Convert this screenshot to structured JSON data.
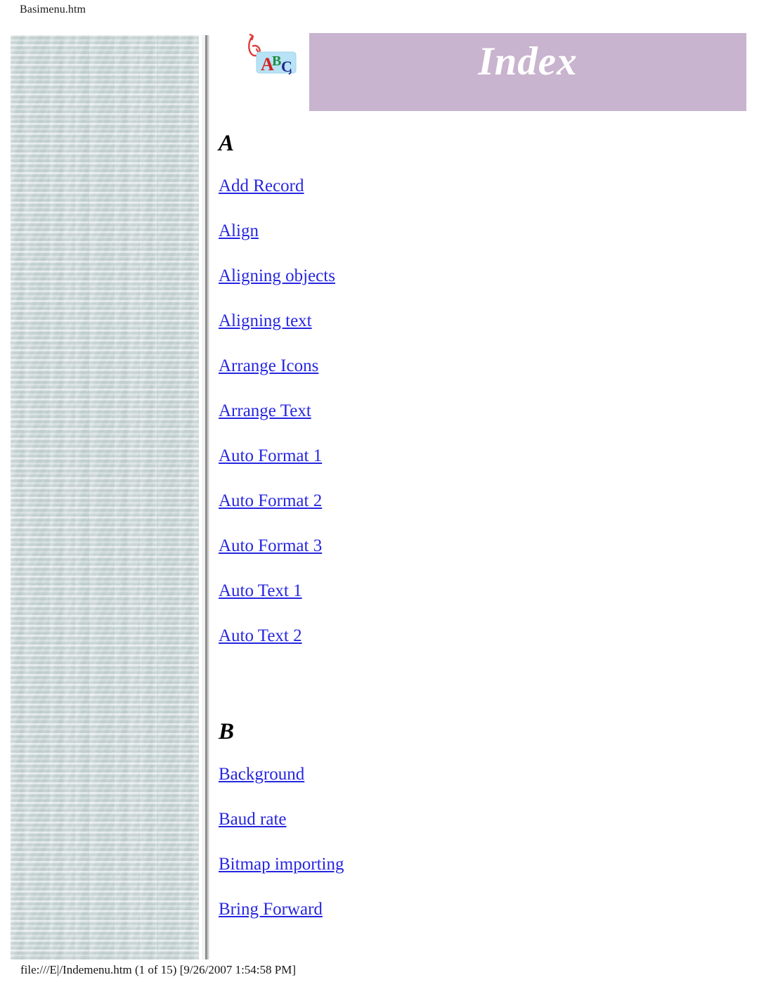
{
  "page": {
    "caption": "Basimenu.htm",
    "footer_path": "file:///E|/Indemenu.htm (1 of 15) [9/26/2007 1:54:58 PM]"
  },
  "colors": {
    "banner_background": "#c8b4ce",
    "banner_text": "#ffffff",
    "link": "#2626e0",
    "sidebar_texture": "#ccd8d7",
    "sidebar_divider": "#8f8f8f",
    "page_background": "#ffffff",
    "abc_tile": "#b8e2f5",
    "abc_a": "#d42020",
    "abc_b": "#1f8c3f",
    "abc_c": "#1f2a8c",
    "abc_arrow": "#e03a3a"
  },
  "masthead": {
    "icon_name": "abc-spellcheck-icon",
    "icon_letters": [
      "A",
      "B",
      "C"
    ],
    "title": "Index"
  },
  "sidebar": {
    "name": "decorative-texture-panel"
  },
  "index": {
    "groups": [
      {
        "letter": "A",
        "links": [
          {
            "label": "Add Record"
          },
          {
            "label": "Align"
          },
          {
            "label": "Aligning objects"
          },
          {
            "label": "Aligning text"
          },
          {
            "label": "Arrange Icons"
          },
          {
            "label": "Arrange Text"
          },
          {
            "label": "Auto Format 1"
          },
          {
            "label": "Auto Format 2"
          },
          {
            "label": "Auto Format 3"
          },
          {
            "label": "Auto Text 1"
          },
          {
            "label": "Auto Text 2"
          }
        ]
      },
      {
        "letter": "B",
        "links": [
          {
            "label": "Background"
          },
          {
            "label": "Baud rate"
          },
          {
            "label": "Bitmap importing"
          },
          {
            "label": "Bring Forward"
          }
        ]
      }
    ]
  }
}
